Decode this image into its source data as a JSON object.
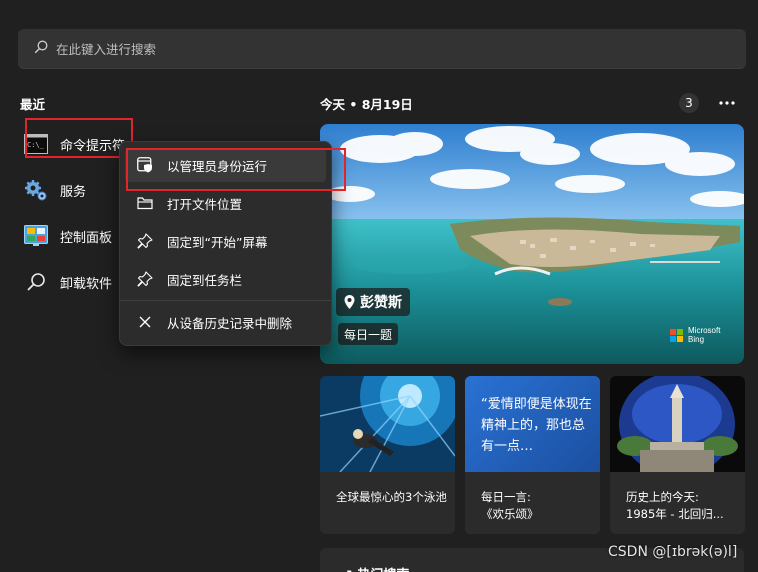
{
  "search": {
    "placeholder": "在此键入进行搜索",
    "icon": "search-icon"
  },
  "recent": {
    "title": "最近",
    "items": [
      {
        "label": "命令提示符",
        "icon": "cmd-icon"
      },
      {
        "label": "服务",
        "icon": "services-gear-icon"
      },
      {
        "label": "控制面板",
        "icon": "control-panel-icon"
      },
      {
        "label": "卸载软件",
        "icon": "search-icon"
      }
    ]
  },
  "context_menu": {
    "items": [
      {
        "label": "以管理员身份运行",
        "icon": "shield-window-icon"
      },
      {
        "label": "打开文件位置",
        "icon": "folder-icon"
      },
      {
        "label": "固定到“开始”屏幕",
        "icon": "pin-icon"
      },
      {
        "label": "固定到任务栏",
        "icon": "pin-icon"
      },
      {
        "label": "从设备历史记录中删除",
        "icon": "close-icon"
      }
    ]
  },
  "today": {
    "title": "今天 • 8月19日",
    "badge_count": "3",
    "more_icon": "more-dots-icon"
  },
  "hero": {
    "location": "彭赞斯",
    "daily": "每日一题",
    "brand_line1": "Microsoft",
    "brand_line2": "Bing",
    "brand_colors": [
      "#f25022",
      "#7fba00",
      "#00a4ef",
      "#ffb900"
    ]
  },
  "cards": [
    {
      "caption": "全球最惊心的3个泳池"
    },
    {
      "quote": "“爱情即便是体现在精神上的，那也总有一点…",
      "caption_line1": "每日一言:",
      "caption_line2": "《欢乐颂》"
    },
    {
      "caption_line1": "历史上的今天:",
      "caption_line2": "1985年 - 北回归..."
    }
  ],
  "hot_search": {
    "title": "↗ 热门搜索"
  },
  "watermark": "CSDN @[ɪbrək(ə)l]",
  "colors": {
    "highlight_border": "#e0262d",
    "background": "#202020",
    "panel": "#2c2c2c"
  }
}
